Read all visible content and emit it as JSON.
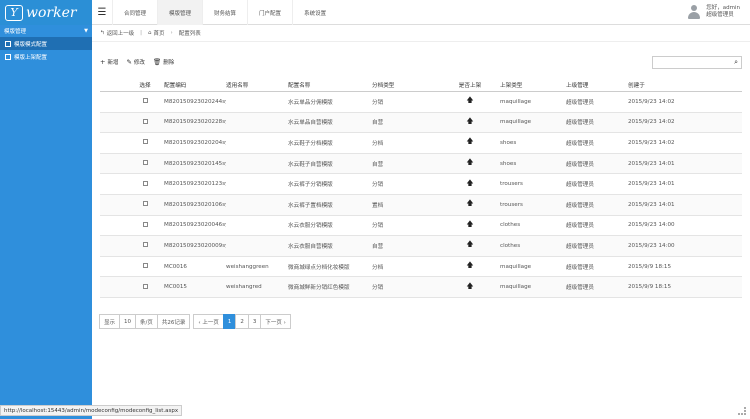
{
  "logo": {
    "mark": "Y",
    "text": "worker"
  },
  "topnav": {
    "items": [
      "合同管理",
      "模版管理",
      "财务结算",
      "门户配置",
      "系统设置"
    ],
    "active_index": 1
  },
  "user": {
    "line1": "您好，admin",
    "line2": "超级管理员"
  },
  "sidebar": {
    "header": "模版管理",
    "items": [
      {
        "label": "模版模式配置",
        "active": true
      },
      {
        "label": "模版上架配置",
        "active": false
      }
    ]
  },
  "breadcrumb": {
    "back": "返回上一级",
    "home": "首页",
    "current": "配置列表"
  },
  "toolbar": {
    "add": "新增",
    "edit": "修改",
    "delete": "删除"
  },
  "table": {
    "headers": [
      "选择",
      "配置编码",
      "适用名称",
      "配置名称",
      "分档类型",
      "是否上架",
      "上架类型",
      "上级管理",
      "创建于"
    ],
    "rows": [
      [
        "M820150923020244syj",
        "",
        "水云单品分佣模版",
        "分销",
        "maquillage",
        "超级管理员",
        "2015/9/23 14:02"
      ],
      [
        "M820150923020228syj",
        "",
        "水云单品自营模版",
        "自营",
        "maquillage",
        "超级管理员",
        "2015/9/23 14:02"
      ],
      [
        "M820150923020204syj",
        "",
        "水云鞋子分档模版",
        "分档",
        "shoes",
        "超级管理员",
        "2015/9/23 14:02"
      ],
      [
        "M820150923020145syj",
        "",
        "水云鞋子自营模版",
        "自营",
        "shoes",
        "超级管理员",
        "2015/9/23 14:01"
      ],
      [
        "M820150923020123syj",
        "",
        "水云裤子分销模版",
        "分销",
        "trousers",
        "超级管理员",
        "2015/9/23 14:01"
      ],
      [
        "M820150923020106syj",
        "",
        "水云裤子置档模版",
        "置档",
        "trousers",
        "超级管理员",
        "2015/9/23 14:01"
      ],
      [
        "M820150923020046syj",
        "",
        "水云衣服分销模版",
        "分销",
        "clothes",
        "超级管理员",
        "2015/9/23 14:00"
      ],
      [
        "M820150923020009syj",
        "",
        "水云衣服自营模版",
        "自营",
        "clothes",
        "超级管理员",
        "2015/9/23 14:00"
      ],
      [
        "MC0016",
        "weishanggreen",
        "微商城绿点分档化妆模版",
        "分档",
        "maquillage",
        "超级管理员",
        "2015/9/9 18:15"
      ],
      [
        "MC0015",
        "weishangred",
        "微商城鲜新分销红色模版",
        "分销",
        "maquillage",
        "超级管理员",
        "2015/9/9 18:15"
      ]
    ]
  },
  "pager": {
    "show": "显示",
    "page_size": "10",
    "per_page": "条/页",
    "total": "共26记录",
    "prev": "‹ 上一页",
    "pages": [
      "1",
      "2",
      "3"
    ],
    "current": "1",
    "next": "下一页 ›"
  },
  "status_url": "http://localhost:15443/admin/modeconfig/modeconfig_list.aspx",
  "colors": {
    "accent": "#2f8fdc",
    "sidebar_active": "#1f6fb3"
  },
  "icons": {
    "menu": "menu-icon",
    "home": "home-icon",
    "search": "search-icon",
    "pin": "pin-up-icon"
  }
}
